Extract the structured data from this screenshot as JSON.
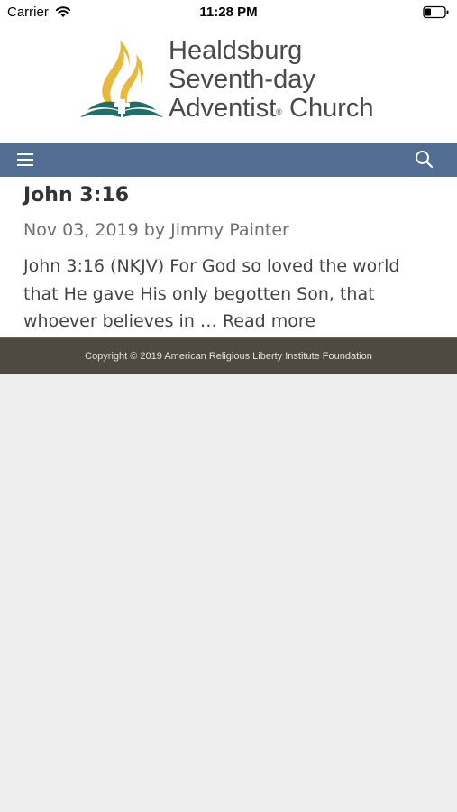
{
  "status_bar": {
    "carrier": "Carrier",
    "time": "11:28 PM"
  },
  "header": {
    "logo_line1": "Healdsburg",
    "logo_line2": "Seventh-day",
    "logo_line3a": "Adventist",
    "logo_registered": "®",
    "logo_line3b": " Church"
  },
  "navbar": {
    "color": "#516d91",
    "menu_icon": "hamburger-menu-icon",
    "search_icon": "search-icon"
  },
  "post": {
    "title": "John 3:16",
    "date": "Nov 03, 2019",
    "by": "by",
    "author": "Jimmy Painter",
    "excerpt": "John 3:16 (NKJV) For God so loved the world that He gave His only begotten Son, that whoever believes in … ",
    "read_more": "Read more"
  },
  "footer": {
    "copyright": "Copyright © 2019 American Religious Liberty Institute Foundation"
  }
}
